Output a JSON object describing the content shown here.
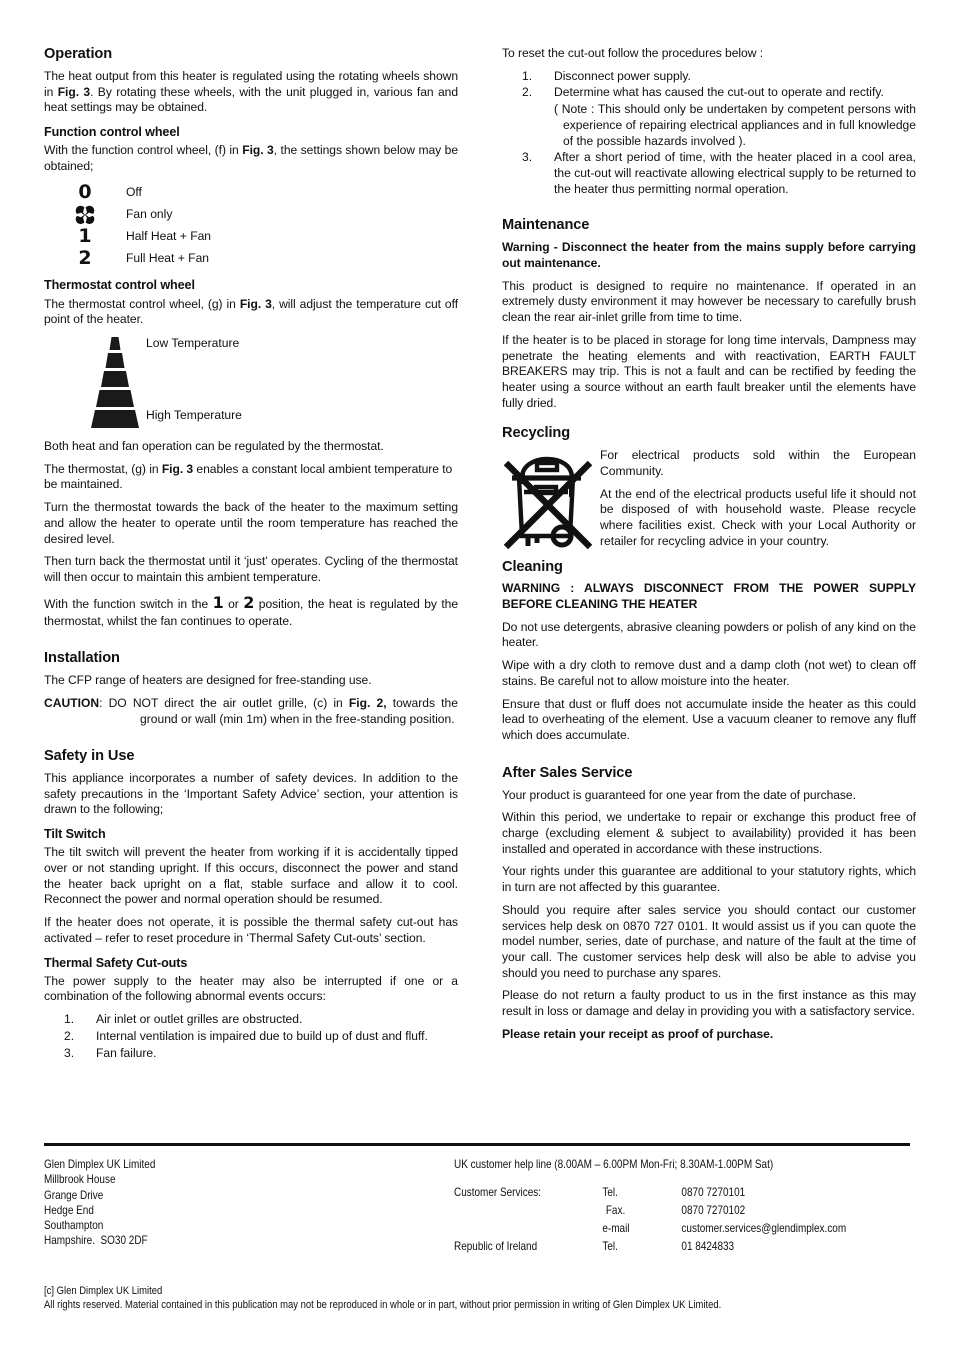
{
  "document": {
    "type": "heater-instruction-manual-page"
  },
  "left_column": {
    "operation": {
      "heading": "Operation",
      "intro": "The heat output from this heater is regulated using the rotating wheels shown in Fig. 3. By rotating these wheels, with the unit plugged in, various fan and heat settings may be obtained."
    },
    "function_control_wheel": {
      "heading": "Function control wheel",
      "intro": "With the function control wheel, (f) in Fig. 3, the settings shown below may be obtained;",
      "settings": [
        {
          "symbol": "0",
          "symbol_name": "zero-glyph",
          "label": "Off"
        },
        {
          "symbol": "fan",
          "symbol_name": "fan-clover-glyph",
          "label": "Fan only"
        },
        {
          "symbol": "1",
          "symbol_name": "one-glyph",
          "label": "Half Heat + Fan"
        },
        {
          "symbol": "2",
          "symbol_name": "two-glyph",
          "label": "Full Heat + Fan"
        }
      ]
    },
    "thermostat_control_wheel": {
      "heading": "Thermostat control wheel",
      "intro": "The thermostat control wheel, (g) in Fig. 3, will adjust the temperature cut off point of the heater.",
      "scale_low_label": "Low  Temperature",
      "scale_high_label": "High Temperature",
      "para1": "Both heat and fan operation can be regulated by the thermostat.",
      "para2": "The thermostat, (g) in Fig. 3 enables a constant local ambient temperature to be maintained.",
      "para3": "Turn the thermostat towards the back of the heater to the maximum setting and allow the heater to operate until the room temperature has reached the desired level.",
      "para4": "Then turn back the thermostat until it ‘just’ operates. Cycling of the thermostat will then occur to maintain this ambient temperature.",
      "para5_a": "With the function switch in the ",
      "para5_sym1": "1",
      "para5_b": " or ",
      "para5_sym2": "2",
      "para5_c": " position, the heat is regulated by the thermostat, whilst the fan continues to operate."
    },
    "installation": {
      "heading": "Installation",
      "para1": "The CFP range of heaters are designed for free-standing use.",
      "caution_label": "CAUTION",
      "caution_text": ": DO NOT direct the air outlet grille, (c) in Fig. 2, towards the ground or wall (min 1m) when in the free-standing position."
    },
    "safety_in_use": {
      "heading": "Safety in Use",
      "para1": "This appliance incorporates a number of safety devices. In addition to the safety precautions in the ‘Important Safety Advice’ section, your attention is drawn to the following;"
    },
    "tilt_switch": {
      "heading": "Tilt Switch",
      "para1": "The tilt switch will prevent the heater from working if it is accidentally tipped over or not standing upright. If this occurs, disconnect the power and stand the heater back upright on a flat, stable surface and allow it to cool. Reconnect the power and normal operation should be resumed.",
      "para2": "If the heater does not operate, it is possible the thermal safety cut-out has activated – refer to reset procedure in ‘Thermal Safety Cut-outs’ section."
    },
    "thermal_safety_cutouts": {
      "heading": "Thermal Safety Cut-outs",
      "para1": "The power supply to the heater may also be interrupted if one or a combination of the following abnormal events occurs:",
      "items": [
        {
          "num": "1.",
          "text": "Air inlet or outlet grilles are obstructed."
        },
        {
          "num": "2.",
          "text": "Internal ventilation is impaired due to build up of dust and fluff."
        },
        {
          "num": "3.",
          "text": "Fan failure."
        }
      ]
    }
  },
  "right_column": {
    "reset": {
      "intro": "To reset the cut-out follow the procedures below :",
      "items": [
        {
          "num": "1.",
          "text": "Disconnect power supply."
        },
        {
          "num": "2.",
          "text": "Determine what has caused the cut-out to operate and rectify."
        },
        {
          "num": "3.",
          "text": "After a short period of time, with the heater placed in a cool area, the cut-out will reactivate allowing electrical supply to be returned to the heater thus permitting normal operation."
        }
      ],
      "note": "( Note : This should only be undertaken by competent persons with experience of repairing electrical appliances and in full knowledge of the possible hazards involved )."
    },
    "maintenance": {
      "heading": "Maintenance",
      "warning": "Warning  -  Disconnect the heater from the mains supply before carrying out maintenance.",
      "para1": "This product is designed to require no maintenance. If operated in an extremely dusty environment it may however be necessary to carefully brush clean the rear air-inlet grille from time to time.",
      "para2": "If the heater is to be placed in storage for long time intervals, Dampness may penetrate the heating elements and with reactivation, EARTH FAULT BREAKERS may trip. This is not a fault and can be rectified by feeding the heater using a source without an earth fault breaker until the elements have fully dried."
    },
    "recycling": {
      "heading": "Recycling",
      "icon_name": "crossed-out-wheelie-bin-icon",
      "para1": "For electrical products sold within the European Community.",
      "para2": "At the end of the electrical products useful life it should not be disposed of with household waste. Please recycle where facilities exist. Check with your Local Authority or retailer for recycling advice in your country."
    },
    "cleaning": {
      "heading": "Cleaning",
      "warning": "WARNING : ALWAYS DISCONNECT FROM THE POWER SUPPLY BEFORE CLEANING THE HEATER",
      "para1": "Do not use detergents, abrasive cleaning powders or polish of any kind on the heater.",
      "para2": "Wipe with a dry cloth to remove dust and a damp cloth (not wet) to clean off stains. Be careful not to allow moisture into the heater.",
      "para3": "Ensure that dust or fluff does not accumulate inside the heater as this could lead to overheating of the element. Use a vacuum cleaner to remove any fluff which does accumulate."
    },
    "after_sales": {
      "heading": "After Sales Service",
      "para1": "Your product is guaranteed for one year from the date of purchase.",
      "para2": "Within this period, we undertake to repair or exchange this product free of charge (excluding element & subject to availability) provided it has been installed and operated in accordance with these instructions.",
      "para3": "Your rights under this guarantee are additional to your statutory rights, which in turn are not affected by this guarantee.",
      "para4": "Should you require after sales service you should contact our customer services help desk on 0870 727 0101.  It would assist us if you can quote the model number, series, date of purchase, and nature of the fault at the time of your call.  The customer services help desk will also be able to advise you should you need to purchase any spares.",
      "para5": "Please do not return a faulty product to us in the first instance as this may result in loss or damage and delay in providing you with a satisfactory service.",
      "closing": "Please retain your receipt as proof of purchase."
    }
  },
  "footer": {
    "address": [
      "Glen Dimplex UK Limited",
      "Millbrook House",
      "Grange Drive",
      "Hedge End",
      "Southampton",
      "Hampshire.  SO30 2DF"
    ],
    "helpline": "UK customer help line (8.00AM – 6.00PM Mon-Fri; 8.30AM-1.00PM Sat)",
    "contacts": [
      {
        "party": "Customer  Services:",
        "channel": "Tel.",
        "value": "0870 7270101"
      },
      {
        "party": "",
        "channel": "Fax.",
        "value": "0870 7270102"
      },
      {
        "party": "",
        "channel": "e-mail",
        "value": "customer.services@glendimplex.com"
      },
      {
        "party": "Republic of Ireland",
        "channel": "Tel.",
        "value": "01 8424833"
      }
    ],
    "copyright_line1": "[c] Glen Dimplex UK Limited",
    "copyright_line2": "All rights reserved. Material contained in this publication may not be reproduced in whole or in part, without prior permission in writing of Glen Dimplex UK Limited."
  }
}
